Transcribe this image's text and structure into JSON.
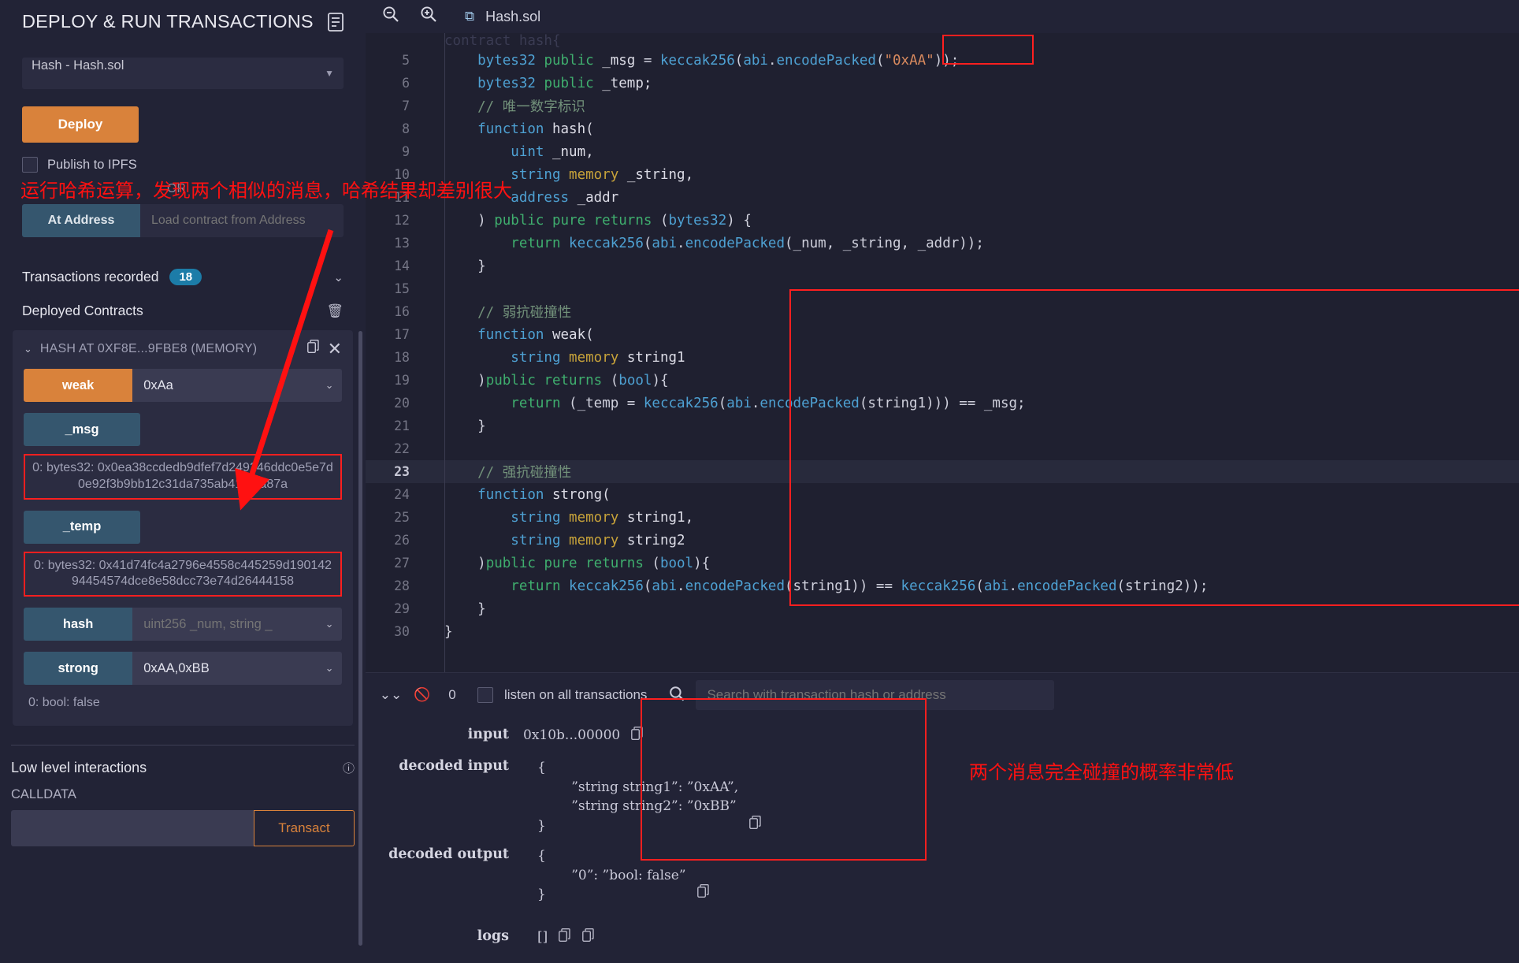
{
  "sidebar": {
    "title": "DEPLOY & RUN TRANSACTIONS",
    "book_icon": "book-icon",
    "contract_select": {
      "value": "Hash - Hash.sol",
      "caret": "chevron-down-icon"
    },
    "deploy_label": "Deploy",
    "publish_ipfs_label": "Publish to IPFS",
    "or_label": "OR",
    "at_address_label": "At Address",
    "at_address_placeholder": "Load contract from Address",
    "transactions_recorded_label": "Transactions recorded",
    "transactions_recorded_count": "18",
    "deployed_contracts_label": "Deployed Contracts",
    "contract_card": {
      "name": "HASH AT 0XF8E...9FBE8 (MEMORY)",
      "copy_icon": "copy-icon",
      "close_icon": "close-icon",
      "chevron_icon": "chevron-down-icon",
      "rows": [
        {
          "btn": "weak",
          "style": "orange",
          "value": "0xAa",
          "caret": true
        },
        {
          "btn": "_msg",
          "style": "blue",
          "value": "",
          "caret": false,
          "result": "0: bytes32: 0x0ea38ccdedb9dfef7d249246ddc0e5e7d0e92f3b9bb12c31da735ab41f08a87a"
        },
        {
          "btn": "_temp",
          "style": "blue",
          "value": "",
          "caret": false,
          "result": "0: bytes32: 0x41d74fc4a2796e4558c445259d19014294454574dce8e58dcc73e74d26444158"
        },
        {
          "btn": "hash",
          "style": "blue",
          "value": "uint256 _num, string _",
          "placeholder": true,
          "caret": true
        },
        {
          "btn": "strong",
          "style": "blue",
          "value": "0xAA,0xBB",
          "caret": true
        }
      ],
      "bool_result": "0: bool: false"
    },
    "low_level_title": "Low level interactions",
    "info_icon": "info-icon",
    "calldata_label": "CALLDATA",
    "calldata_value": "",
    "transact_label": "Transact"
  },
  "editor": {
    "zoom_out_icon": "zoom-out-icon",
    "zoom_in_icon": "zoom-in-icon",
    "file_icon": "solidity-icon",
    "filename": "Hash.sol",
    "current_line": 23,
    "lines": [
      {
        "n": "4",
        "text": "contract hash{",
        "clipped": true
      },
      {
        "n": "5",
        "tokens": [
          [
            "k-type",
            "    bytes32 "
          ],
          [
            "k-vis",
            "public "
          ],
          [
            "k-id",
            "_msg "
          ],
          [
            "k-op",
            "= "
          ],
          [
            "k-call",
            "keccak256"
          ],
          [
            "k-op",
            "("
          ],
          [
            "k-abi",
            "abi"
          ],
          [
            "k-op",
            "."
          ],
          [
            "k-call",
            "encodePacked"
          ],
          [
            "k-op",
            "("
          ],
          [
            "k-str",
            "\"0xAA\""
          ],
          [
            "k-op",
            "));"
          ]
        ]
      },
      {
        "n": "6",
        "tokens": [
          [
            "k-type",
            "    bytes32 "
          ],
          [
            "k-vis",
            "public "
          ],
          [
            "k-id",
            "_temp;"
          ]
        ]
      },
      {
        "n": "7",
        "tokens": [
          [
            "k-cmt",
            "    // 唯一数字标识"
          ]
        ]
      },
      {
        "n": "8",
        "tokens": [
          [
            "k-kw",
            "    function "
          ],
          [
            "k-id",
            "hash("
          ]
        ]
      },
      {
        "n": "9",
        "tokens": [
          [
            "k-type",
            "        uint "
          ],
          [
            "k-id",
            "_num,"
          ]
        ]
      },
      {
        "n": "10",
        "tokens": [
          [
            "k-type",
            "        string "
          ],
          [
            "k-mem",
            "memory "
          ],
          [
            "k-id",
            "_string,"
          ]
        ]
      },
      {
        "n": "11",
        "tokens": [
          [
            "k-type",
            "        address "
          ],
          [
            "k-id",
            "_addr"
          ]
        ]
      },
      {
        "n": "12",
        "tokens": [
          [
            "k-op",
            "    ) "
          ],
          [
            "k-vis",
            "public pure returns "
          ],
          [
            "k-op",
            "("
          ],
          [
            "k-type",
            "bytes32"
          ],
          [
            "k-op",
            ") {"
          ]
        ]
      },
      {
        "n": "13",
        "tokens": [
          [
            "k-vis",
            "        return "
          ],
          [
            "k-call",
            "keccak256"
          ],
          [
            "k-op",
            "("
          ],
          [
            "k-abi",
            "abi"
          ],
          [
            "k-op",
            "."
          ],
          [
            "k-call",
            "encodePacked"
          ],
          [
            "k-op",
            "(_num, _string, _addr));"
          ]
        ]
      },
      {
        "n": "14",
        "tokens": [
          [
            "k-op",
            "    }"
          ]
        ]
      },
      {
        "n": "15",
        "tokens": [
          [
            "k-op",
            ""
          ]
        ]
      },
      {
        "n": "16",
        "tokens": [
          [
            "k-cmt",
            "    // 弱抗碰撞性"
          ]
        ]
      },
      {
        "n": "17",
        "tokens": [
          [
            "k-kw",
            "    function "
          ],
          [
            "k-id",
            "weak("
          ]
        ]
      },
      {
        "n": "18",
        "tokens": [
          [
            "k-type",
            "        string "
          ],
          [
            "k-mem",
            "memory "
          ],
          [
            "k-id",
            "string1"
          ]
        ]
      },
      {
        "n": "19",
        "tokens": [
          [
            "k-op",
            "    )"
          ],
          [
            "k-vis",
            "public returns "
          ],
          [
            "k-op",
            "("
          ],
          [
            "k-type",
            "bool"
          ],
          [
            "k-op",
            "){"
          ]
        ]
      },
      {
        "n": "20",
        "tokens": [
          [
            "k-vis",
            "        return "
          ],
          [
            "k-op",
            "(_temp = "
          ],
          [
            "k-call",
            "keccak256"
          ],
          [
            "k-op",
            "("
          ],
          [
            "k-abi",
            "abi"
          ],
          [
            "k-op",
            "."
          ],
          [
            "k-call",
            "encodePacked"
          ],
          [
            "k-op",
            "(string1))) == _msg;"
          ]
        ]
      },
      {
        "n": "21",
        "tokens": [
          [
            "k-op",
            "    }"
          ]
        ]
      },
      {
        "n": "22",
        "tokens": [
          [
            "k-op",
            ""
          ]
        ]
      },
      {
        "n": "23",
        "tokens": [
          [
            "k-cmt",
            "    // 强抗碰撞性"
          ]
        ],
        "highlight": true
      },
      {
        "n": "24",
        "tokens": [
          [
            "k-kw",
            "    function "
          ],
          [
            "k-id",
            "strong("
          ]
        ]
      },
      {
        "n": "25",
        "tokens": [
          [
            "k-type",
            "        string "
          ],
          [
            "k-mem",
            "memory "
          ],
          [
            "k-id",
            "string1,"
          ]
        ]
      },
      {
        "n": "26",
        "tokens": [
          [
            "k-type",
            "        string "
          ],
          [
            "k-mem",
            "memory "
          ],
          [
            "k-id",
            "string2"
          ]
        ]
      },
      {
        "n": "27",
        "tokens": [
          [
            "k-op",
            "    )"
          ],
          [
            "k-vis",
            "public pure returns "
          ],
          [
            "k-op",
            "("
          ],
          [
            "k-type",
            "bool"
          ],
          [
            "k-op",
            "){"
          ]
        ]
      },
      {
        "n": "28",
        "tokens": [
          [
            "k-vis",
            "        return "
          ],
          [
            "k-call",
            "keccak256"
          ],
          [
            "k-op",
            "("
          ],
          [
            "k-abi",
            "abi"
          ],
          [
            "k-op",
            "."
          ],
          [
            "k-call",
            "encodePacked"
          ],
          [
            "k-op",
            "(string1)) == "
          ],
          [
            "k-call",
            "keccak256"
          ],
          [
            "k-op",
            "("
          ],
          [
            "k-abi",
            "abi"
          ],
          [
            "k-op",
            "."
          ],
          [
            "k-call",
            "encodePacked"
          ],
          [
            "k-op",
            "(string2));"
          ]
        ]
      },
      {
        "n": "29",
        "tokens": [
          [
            "k-op",
            "    }"
          ]
        ]
      },
      {
        "n": "30",
        "tokens": [
          [
            "k-op",
            "}"
          ]
        ]
      }
    ]
  },
  "terminal": {
    "collapse_icon": "chevrons-down-icon",
    "block_icon": "no-entry-icon",
    "count": "0",
    "listen_label": "listen on all transactions",
    "search_icon": "search-icon",
    "search_placeholder": "Search with transaction hash or address",
    "rows": [
      {
        "label": "input",
        "value": "0x10b...00000",
        "copy": "copy-icon"
      },
      {
        "label": "decoded input",
        "json": "{\n        ”string string1”: ”0xAA”,\n        ”string string2”: ”0xBB”\n}",
        "copy": "copy-icon"
      },
      {
        "label": "decoded output",
        "json": "{\n        ”0”: ”bool: false”\n}",
        "copy": "copy-icon"
      },
      {
        "label": "logs",
        "value": "[]",
        "copy": "copy-icon",
        "copy2": "copy-icon"
      }
    ]
  },
  "annotations": {
    "note_left": "运行哈希运算，发现两个相似的消息，哈希结果却差别很大",
    "note_right": "两个消息完全碰撞的概率非常低"
  },
  "colors": {
    "accent_orange": "#d9823b",
    "accent_blue": "#35566e",
    "badge_blue": "#1c7ca8",
    "annotation_red": "#ff1111",
    "background": "#222336",
    "editor_bg": "#1f2030"
  }
}
